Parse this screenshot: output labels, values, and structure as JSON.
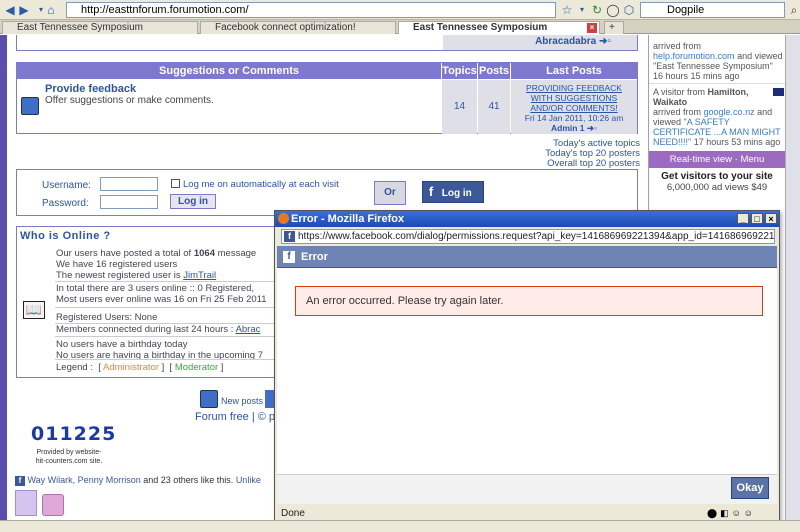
{
  "browser": {
    "url": "http://easttnforum.forumotion.com/",
    "search_engine": "Dogpile",
    "tabs": [
      {
        "label": "East Tennessee Symposium"
      },
      {
        "label": "Facebook connect optimization!"
      },
      {
        "label": "East Tennessee Symposium"
      }
    ]
  },
  "forum": {
    "top_last_post": "Abracadabra",
    "category_header": "Suggestions or Comments",
    "col_topics": "Topics",
    "col_posts": "Posts",
    "col_last_posts": "Last Posts",
    "forum_title": "Provide feedback",
    "forum_desc": "Offer suggestions or make comments.",
    "topics": "14",
    "posts": "41",
    "last_post_title": "PROVIDING FEEDBACK WITH SUGGESTIONS AND/OR COMMENTS!",
    "last_post_date": "Fri 14 Jan 2011, 10:26 am",
    "last_post_author": "Admin 1",
    "links": [
      "Today's active topics",
      "Today's top 20 posters",
      "Overall top 20 posters"
    ]
  },
  "login": {
    "username_label": "Username:",
    "password_label": "Password:",
    "auto_login": "Log me on automatically at each visit",
    "login_button": "Log in",
    "or_label": "Or",
    "fb_login": "Log in"
  },
  "who_online": {
    "title": "Who is Online ?",
    "line1_pre": "Our users have posted a total of",
    "line1_num": "1064",
    "line1_post": "message",
    "line2": "We have 16 registered users",
    "line3_pre": "The newest registered user is",
    "line3_user": "JimTrail",
    "line4": "In total there are 3 users online :: 0 Registered,",
    "line5": "Most users ever online was 16 on Fri 25 Feb 2011",
    "line6": "Registered Users: None",
    "line7_pre": "Members connected during last 24 hours :",
    "line7_user": "Abrac",
    "line8": "No users have a birthday today",
    "line9": "No users are having a birthday in the upcoming 7",
    "legend_label": "Legend :",
    "legend_admin": "Administrator",
    "legend_mod": "Moderator"
  },
  "footer": {
    "new_posts": "New posts",
    "forum_free": "Forum free",
    "forum_free_suffix": "| © p",
    "counter": "011225",
    "counter_caption1": "Provided by website-",
    "counter_caption2": "hit-counters.com site.",
    "like_text_names": "Way Wilark, Penny Morrison",
    "like_text_rest": "and 23 others like this.",
    "unlike": "Unlike"
  },
  "sidebar": {
    "entry1_a": "arrived from",
    "entry1_site": "help.forumotion.com",
    "entry1_b": "and viewed \"East Tennessee Symposium\" 16 hours 15 mins ago",
    "entry2_a": "A visitor from",
    "entry2_loc": "Hamilton, Waikato",
    "entry2_b": "arrived from",
    "entry2_site": "google.co.nz",
    "entry2_c": "and viewed",
    "entry2_page": "\"A SAFETY CERTIFICATE ...A MAN MIGHT NEED!!!!\"",
    "entry2_time": "17 hours 53 mins ago",
    "realtime": "Real-time view · Menu",
    "ad_title": "Get visitors to your site",
    "ad_sub": "6,000,000 ad views $49"
  },
  "popup": {
    "window_title": "Error - Mozilla Firefox",
    "url": "https://www.facebook.com/dialog/permissions.request?api_key=141686969221394&app_id=141686969221394&displa",
    "header": "Error",
    "message": "An error occurred. Please try again later.",
    "okay_button": "Okay",
    "status": "Done"
  },
  "colors": {
    "forum_header": "#7d78d0",
    "link": "#2a55a5",
    "fb_blue": "#3b5998",
    "error_bg": "#ffebe8"
  }
}
